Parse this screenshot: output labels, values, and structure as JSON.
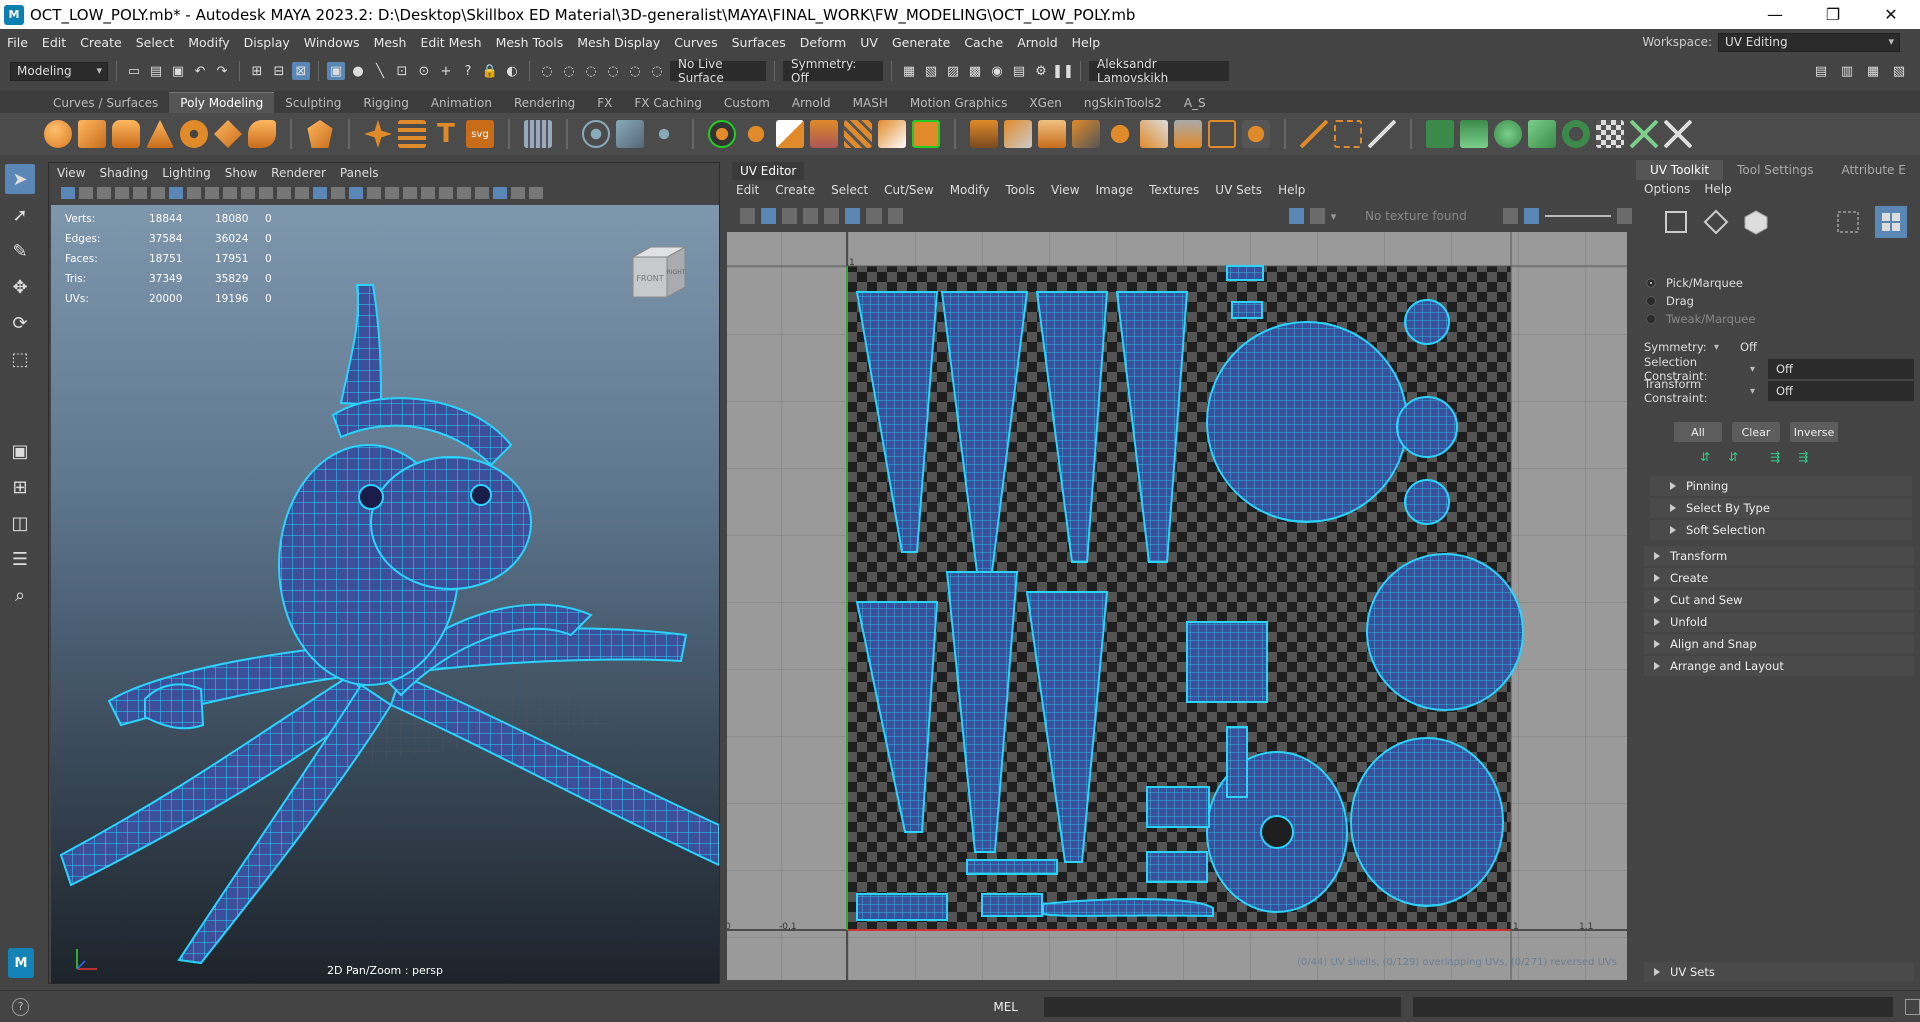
{
  "window": {
    "title": "OCT_LOW_POLY.mb* - Autodesk MAYA 2023.2: D:\\Desktop\\Skillbox ED Material\\3D-generalist\\MAYA\\FINAL_WORK\\FW_MODELING\\OCT_LOW_POLY.mb",
    "logo": "M",
    "minimize": "—",
    "maximize": "❐",
    "close": "✕"
  },
  "menubar": {
    "items": [
      "File",
      "Edit",
      "Create",
      "Select",
      "Modify",
      "Display",
      "Windows",
      "Mesh",
      "Edit Mesh",
      "Mesh Tools",
      "Mesh Display",
      "Curves",
      "Surfaces",
      "Deform",
      "UV",
      "Generate",
      "Cache",
      "Arnold",
      "Help"
    ],
    "workspace_label": "Workspace:",
    "workspace_value": "UV Editing"
  },
  "statusline": {
    "menuset": "Modeling",
    "live_surface": "No Live Surface",
    "symmetry": "Symmetry: Off",
    "user": "Aleksandr Lamovskikh"
  },
  "shelf": {
    "tabs": [
      "Curves / Surfaces",
      "Poly Modeling",
      "Sculpting",
      "Rigging",
      "Animation",
      "Rendering",
      "FX",
      "FX Caching",
      "Custom",
      "Arnold",
      "MASH",
      "Motion Graphics",
      "XGen",
      "ngSkinTools2",
      "A_S"
    ],
    "active_tab": "Poly Modeling",
    "text_tool_glyph": "T",
    "svg_tool_label": "svg"
  },
  "viewport": {
    "menus": [
      "View",
      "Shading",
      "Lighting",
      "Show",
      "Renderer",
      "Panels"
    ],
    "hud": [
      {
        "label": "Verts:",
        "a": "18844",
        "b": "18080",
        "c": "0"
      },
      {
        "label": "Edges:",
        "a": "37584",
        "b": "36024",
        "c": "0"
      },
      {
        "label": "Faces:",
        "a": "18751",
        "b": "17951",
        "c": "0"
      },
      {
        "label": "Tris:",
        "a": "37349",
        "b": "35829",
        "c": "0"
      },
      {
        "label": "UVs:",
        "a": "20000",
        "b": "19196",
        "c": "0"
      }
    ],
    "viewcube_front": "FRONT",
    "viewcube_right": "RIGHT",
    "camera_label": "2D Pan/Zoom : persp",
    "badge": "M"
  },
  "uv_editor": {
    "title": "UV Editor",
    "menus": [
      "Edit",
      "Create",
      "Select",
      "Cut/Sew",
      "Modify",
      "Tools",
      "View",
      "Image",
      "Textures",
      "UV Sets",
      "Help"
    ],
    "texture_status": "No texture found",
    "axis_labels": {
      "zero": "0",
      "neg": "-0.1",
      "one": "1",
      "one_one": "1.1",
      "top_one": "1"
    },
    "status": "(0/44) UV shells, (0/129) overlapping UVs, (0/271) reversed UVs"
  },
  "uv_toolkit": {
    "tabs": [
      "UV Toolkit",
      "Tool Settings",
      "Attribute E"
    ],
    "menus": [
      "Options",
      "Help"
    ],
    "modes": [
      "Pick/Marquee",
      "Drag",
      "Tweak/Marquee"
    ],
    "symmetry_label": "Symmetry:",
    "symmetry_value": "Off",
    "selection_constraint_label": "Selection Constraint:",
    "selection_constraint_value": "Off",
    "transform_constraint_label": "Transform Constraint:",
    "transform_constraint_value": "Off",
    "buttons": [
      "All",
      "Clear",
      "Inverse"
    ],
    "sub_sections": [
      "Pinning",
      "Select By Type",
      "Soft Selection"
    ],
    "sections": [
      "Transform",
      "Create",
      "Cut and Sew",
      "Unfold",
      "Align and Snap",
      "Arrange and Layout"
    ],
    "uv_sets": "UV Sets"
  },
  "cmdline": {
    "help": "?",
    "lang": "MEL"
  },
  "colors": {
    "accent": "#5a87b5",
    "wire": "#2ad4ff",
    "mesh_fill": "#3b4f9a"
  }
}
